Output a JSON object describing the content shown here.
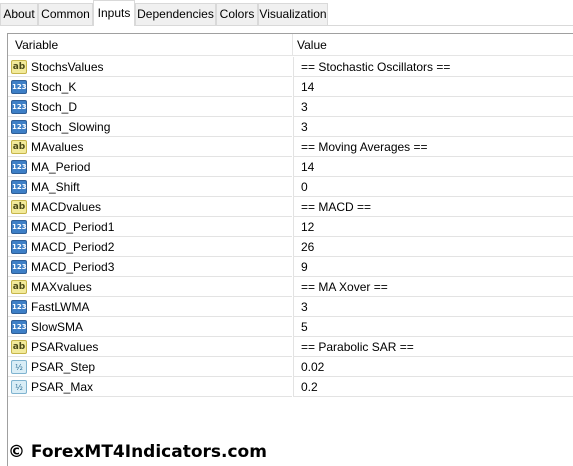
{
  "tabs": [
    {
      "label": "About",
      "active": false
    },
    {
      "label": "Common",
      "active": false
    },
    {
      "label": "Inputs",
      "active": true
    },
    {
      "label": "Dependencies",
      "active": false
    },
    {
      "label": "Colors",
      "active": false
    },
    {
      "label": "Visualization",
      "active": false
    }
  ],
  "table": {
    "headers": {
      "variable": "Variable",
      "value": "Value"
    },
    "rows": [
      {
        "type_icon": "string-icon",
        "variable": "StochsValues",
        "value": "== Stochastic Oscillators =="
      },
      {
        "type_icon": "integer-icon",
        "variable": "Stoch_K",
        "value": "14"
      },
      {
        "type_icon": "integer-icon",
        "variable": "Stoch_D",
        "value": "3"
      },
      {
        "type_icon": "integer-icon",
        "variable": "Stoch_Slowing",
        "value": "3"
      },
      {
        "type_icon": "string-icon",
        "variable": "MAvalues",
        "value": "== Moving Averages =="
      },
      {
        "type_icon": "integer-icon",
        "variable": "MA_Period",
        "value": "14"
      },
      {
        "type_icon": "integer-icon",
        "variable": "MA_Shift",
        "value": "0"
      },
      {
        "type_icon": "string-icon",
        "variable": "MACDvalues",
        "value": "== MACD =="
      },
      {
        "type_icon": "integer-icon",
        "variable": "MACD_Period1",
        "value": "12"
      },
      {
        "type_icon": "integer-icon",
        "variable": "MACD_Period2",
        "value": "26"
      },
      {
        "type_icon": "integer-icon",
        "variable": "MACD_Period3",
        "value": "9"
      },
      {
        "type_icon": "string-icon",
        "variable": "MAXvalues",
        "value": "== MA Xover =="
      },
      {
        "type_icon": "integer-icon",
        "variable": "FastLWMA",
        "value": "3"
      },
      {
        "type_icon": "integer-icon",
        "variable": "SlowSMA",
        "value": "5"
      },
      {
        "type_icon": "string-icon",
        "variable": "PSARvalues",
        "value": "== Parabolic SAR =="
      },
      {
        "type_icon": "double-icon",
        "variable": "PSAR_Step",
        "value": "0.02"
      },
      {
        "type_icon": "double-icon",
        "variable": "PSAR_Max",
        "value": "0.2"
      }
    ]
  },
  "icon_glyphs": {
    "string-icon": "ab",
    "integer-icon": "123",
    "double-icon": "½"
  },
  "watermark": "© ForexMT4Indicators.com"
}
